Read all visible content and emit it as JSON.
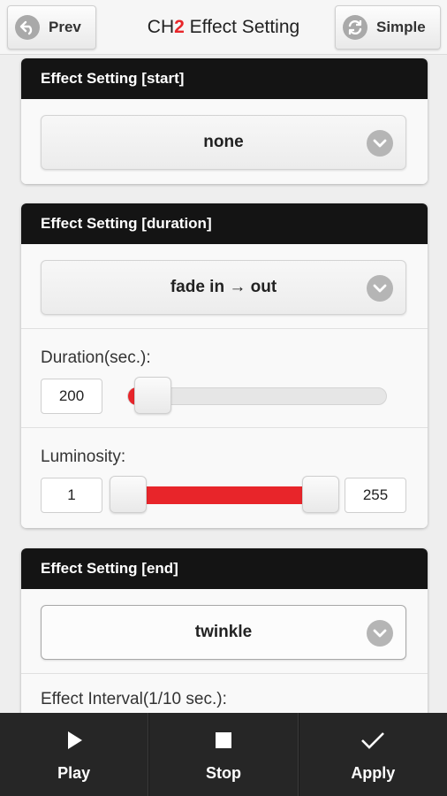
{
  "header": {
    "prev_label": "Prev",
    "title_prefix": "CH",
    "title_channel": "2",
    "title_suffix": " Effect Setting",
    "simple_label": "Simple"
  },
  "effect_start": {
    "title": "Effect Setting [start]",
    "selected": "none"
  },
  "effect_duration": {
    "title": "Effect Setting [duration]",
    "selected": "fade in → out",
    "duration_label": "Duration(sec.):",
    "duration_value": "200",
    "duration_fraction": 0.0,
    "luminosity_label": "Luminosity:",
    "luminosity_min": "1",
    "luminosity_max": "255"
  },
  "effect_end": {
    "title": "Effect Setting [end]",
    "selected": "twinkle",
    "interval_label": "Effect Interval(1/10 sec.):"
  },
  "bottom": {
    "play_label": "Play",
    "stop_label": "Stop",
    "apply_label": "Apply"
  },
  "colors": {
    "accent_red": "#e8252a",
    "panel_header": "#141414",
    "bottom_bar": "#262626"
  }
}
